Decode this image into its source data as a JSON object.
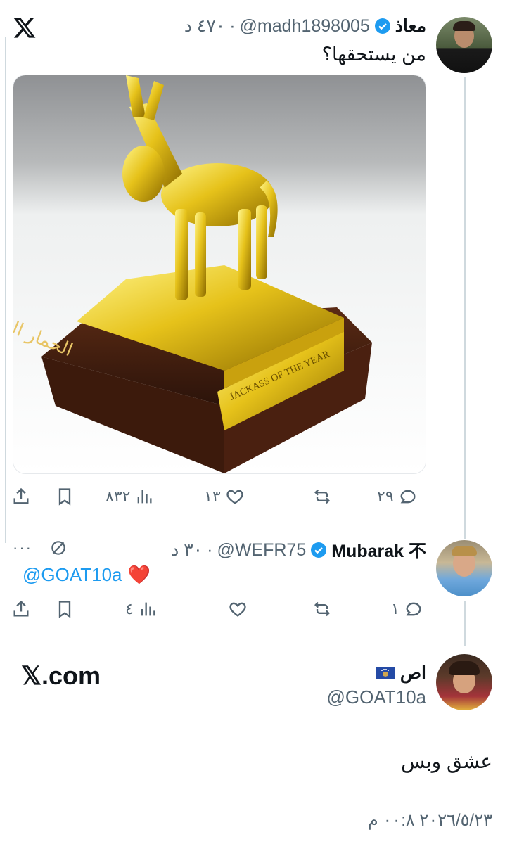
{
  "app": {
    "logo": "x-logo-icon"
  },
  "tweet1": {
    "name": "معاذ",
    "handle": "@madh1898005",
    "time": "٤٧٠ د",
    "separator": "·",
    "text": "من يستحقها؟",
    "image_caption_ar": "الحمار الذهبي",
    "image_plaque": "JACKASS OF THE YEAR",
    "stats": {
      "replies": "٢٩",
      "retweets": "",
      "likes": "١٣",
      "views": "٨٣٢"
    },
    "icons": [
      "reply-icon",
      "retweet-icon",
      "like-icon",
      "views-icon",
      "bookmark-icon",
      "share-icon"
    ]
  },
  "tweet2": {
    "name": "Mubarak 不",
    "handle": "@WEFR75",
    "time": "٣٠ د",
    "separator": "·",
    "mention": "@GOAT10a",
    "emoji": "❤️",
    "more": "···",
    "stats": {
      "replies": "١",
      "retweets": "",
      "likes": "",
      "views": "٤"
    }
  },
  "tweet3": {
    "brand": "𝕏.com",
    "name": "اص",
    "flag": "kosovo-flag-icon",
    "handle": "@GOAT10a",
    "text": "عشق وبس",
    "timestamp": "٢٠٢٦/٥/٢٣ ٠٠:٨ م"
  },
  "colors": {
    "accent": "#1d9bf0",
    "like": "#e0245e",
    "muted": "#536471",
    "gold": "#e6c21a"
  }
}
